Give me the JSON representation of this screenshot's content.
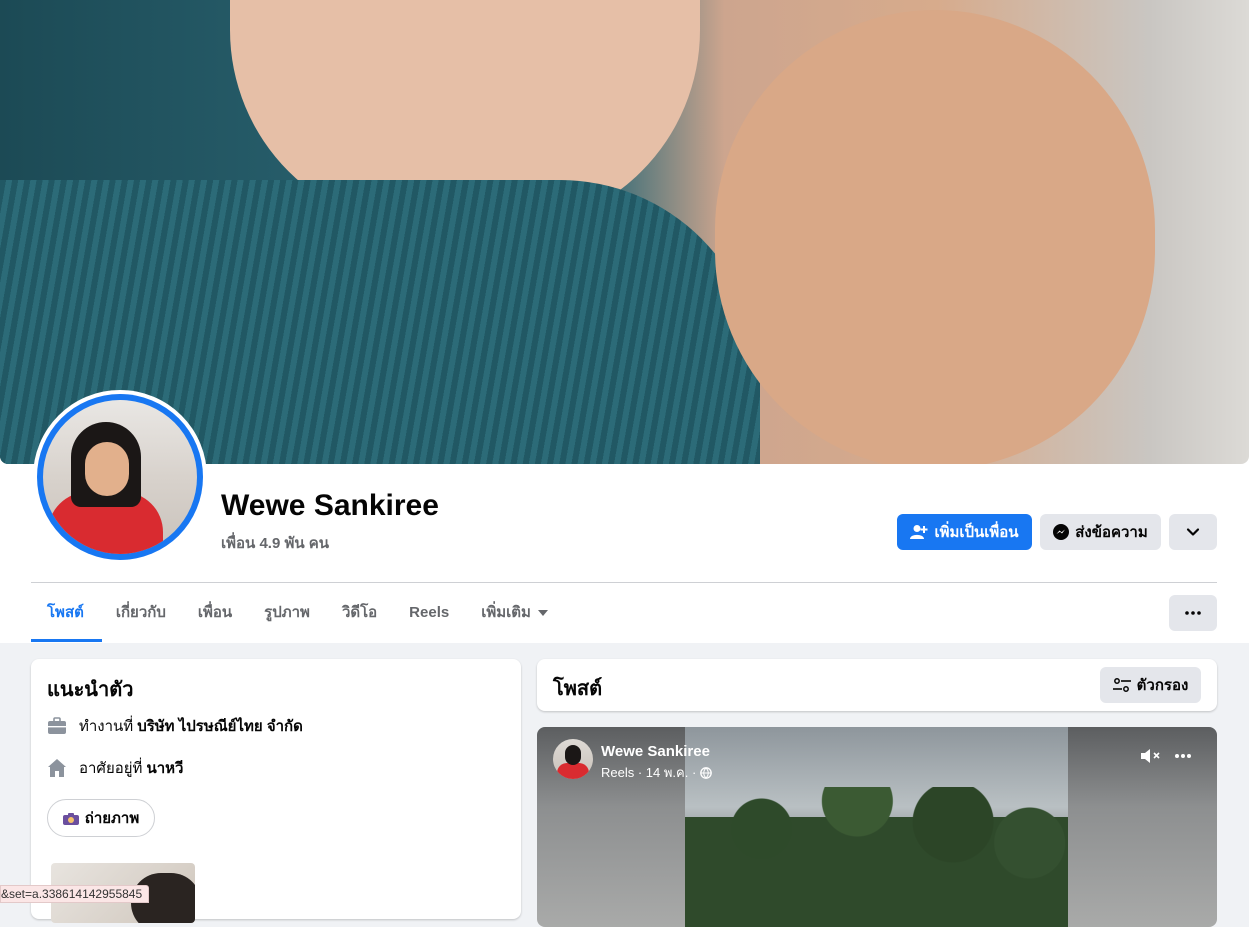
{
  "profile": {
    "name": "Wewe Sankiree",
    "friends_text": "เพื่อน 4.9 พัน คน"
  },
  "actions": {
    "add_friend": "เพิ่มเป็นเพื่อน",
    "message": "ส่งข้อความ"
  },
  "tabs": [
    {
      "label": "โพสต์",
      "active": true
    },
    {
      "label": "เกี่ยวกับ"
    },
    {
      "label": "เพื่อน"
    },
    {
      "label": "รูปภาพ"
    },
    {
      "label": "วิดีโอ"
    },
    {
      "label": "Reels"
    },
    {
      "label": "เพิ่มเติม"
    }
  ],
  "intro": {
    "title": "แนะนำตัว",
    "work_prefix": "ทำงานที่",
    "work_value": "บริษัท ไปรษณีย์ไทย จำกัด",
    "home_prefix": "อาศัยอยู่ที่",
    "home_value": "นาหวี",
    "photo_button": "ถ่ายภาพ"
  },
  "posts": {
    "title": "โพสต์",
    "filter_button": "ตัวกรอง"
  },
  "reel": {
    "author": "Wewe Sankiree",
    "meta": "Reels · 14 พ.ค. ·"
  },
  "status_url": "&set=a.338614142955845",
  "colors": {
    "primary": "#1877f2",
    "secondary_button": "#e4e6eb",
    "page_bg": "#f0f2f5"
  }
}
